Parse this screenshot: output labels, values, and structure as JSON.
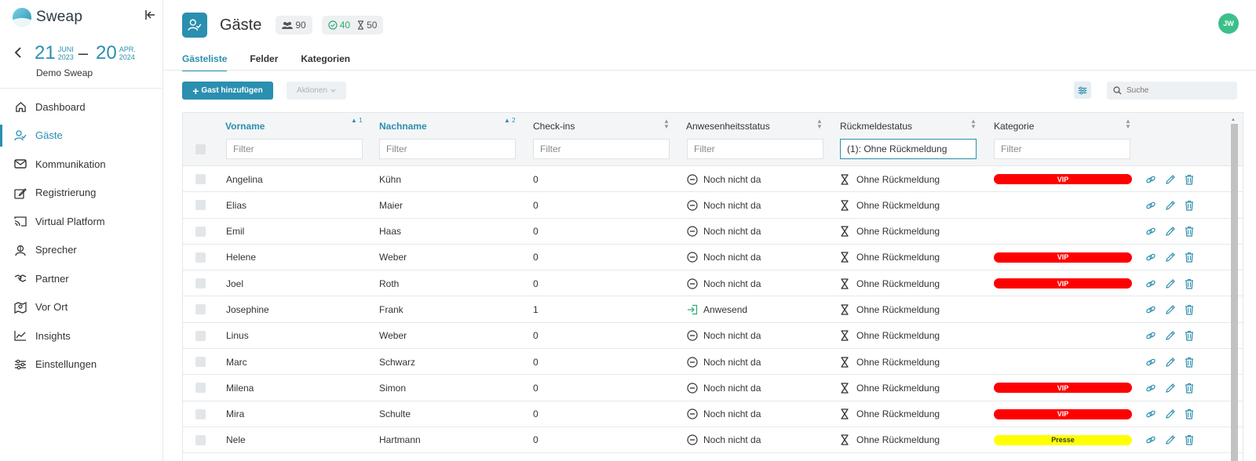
{
  "sidebar": {
    "brand": "Sweap",
    "date_start_day": "21",
    "date_start_month": "JUNI",
    "date_start_year": "2023",
    "date_separator": "–",
    "date_end_day": "20",
    "date_end_month": "APR.",
    "date_end_year": "2024",
    "event_name": "Demo Sweap",
    "items": [
      {
        "label": "Dashboard",
        "icon": "home-icon"
      },
      {
        "label": "Gäste",
        "icon": "user-check-icon"
      },
      {
        "label": "Kommunikation",
        "icon": "mail-icon"
      },
      {
        "label": "Registrierung",
        "icon": "edit-icon"
      },
      {
        "label": "Virtual Platform",
        "icon": "cast-icon"
      },
      {
        "label": "Sprecher",
        "icon": "speaker-icon"
      },
      {
        "label": "Partner",
        "icon": "handshake-icon"
      },
      {
        "label": "Vor Ort",
        "icon": "map-icon"
      },
      {
        "label": "Insights",
        "icon": "chart-line-icon"
      },
      {
        "label": "Einstellungen",
        "icon": "sliders-icon"
      }
    ]
  },
  "header": {
    "title": "Gäste",
    "total_count": "90",
    "confirmed_count": "40",
    "pending_count": "50",
    "avatar_initials": "JW"
  },
  "tabs": [
    "Gästeliste",
    "Felder",
    "Kategorien"
  ],
  "toolbar": {
    "add_label": "Gast hinzufügen",
    "actions_label": "Aktionen",
    "search_placeholder": "Suche"
  },
  "table": {
    "columns": [
      {
        "label": "Vorname",
        "sort": "▲ 1"
      },
      {
        "label": "Nachname",
        "sort": "▲ 2"
      },
      {
        "label": "Check-ins",
        "sort": "▲\n▼"
      },
      {
        "label": "Anwesenheitsstatus",
        "sort": "▲\n▼"
      },
      {
        "label": "Rückmeldestatus",
        "sort": "▲\n▼"
      },
      {
        "label": "Kategorie",
        "sort": "▲\n▼"
      }
    ],
    "filter_placeholder": "Filter",
    "active_filter_value": "(1): Ohne Rückmeldung",
    "rows": [
      {
        "first": "Angelina",
        "last": "Kühn",
        "checkins": "0",
        "attendance": "Noch nicht da",
        "response": "Ohne Rückmeldung",
        "category": "VIP"
      },
      {
        "first": "Elias",
        "last": "Maier",
        "checkins": "0",
        "attendance": "Noch nicht da",
        "response": "Ohne Rückmeldung",
        "category": ""
      },
      {
        "first": "Emil",
        "last": "Haas",
        "checkins": "0",
        "attendance": "Noch nicht da",
        "response": "Ohne Rückmeldung",
        "category": ""
      },
      {
        "first": "Helene",
        "last": "Weber",
        "checkins": "0",
        "attendance": "Noch nicht da",
        "response": "Ohne Rückmeldung",
        "category": "VIP"
      },
      {
        "first": "Joel",
        "last": "Roth",
        "checkins": "0",
        "attendance": "Noch nicht da",
        "response": "Ohne Rückmeldung",
        "category": "VIP"
      },
      {
        "first": "Josephine",
        "last": "Frank",
        "checkins": "1",
        "attendance": "Anwesend",
        "response": "Ohne Rückmeldung",
        "category": ""
      },
      {
        "first": "Linus",
        "last": "Weber",
        "checkins": "0",
        "attendance": "Noch nicht da",
        "response": "Ohne Rückmeldung",
        "category": ""
      },
      {
        "first": "Marc",
        "last": "Schwarz",
        "checkins": "0",
        "attendance": "Noch nicht da",
        "response": "Ohne Rückmeldung",
        "category": ""
      },
      {
        "first": "Milena",
        "last": "Simon",
        "checkins": "0",
        "attendance": "Noch nicht da",
        "response": "Ohne Rückmeldung",
        "category": "VIP"
      },
      {
        "first": "Mira",
        "last": "Schulte",
        "checkins": "0",
        "attendance": "Noch nicht da",
        "response": "Ohne Rückmeldung",
        "category": "VIP"
      },
      {
        "first": "Nele",
        "last": "Hartmann",
        "checkins": "0",
        "attendance": "Noch nicht da",
        "response": "Ohne Rückmeldung",
        "category": "Presse"
      }
    ]
  },
  "colors": {
    "accent": "#2b8fb0",
    "vip": "#ff0000",
    "presse": "#ffff00",
    "present": "#2eaa73",
    "avatar": "#3cc08b"
  }
}
